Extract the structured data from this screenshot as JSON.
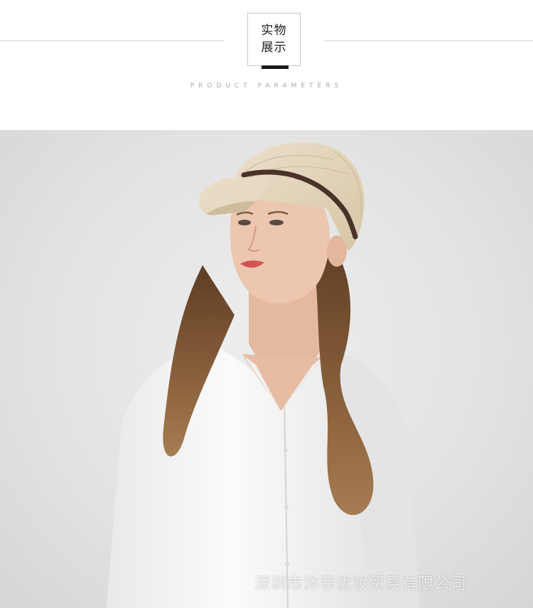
{
  "header": {
    "title_line1": "实物",
    "title_line2": "展示",
    "subtitle": "PRODUCT PARAMETERS"
  },
  "photo": {
    "subject": "woman-wearing-straw-visor-cap",
    "watermark": "深圳市沐菲优妆贸易有限公司"
  },
  "colors": {
    "rule": "#cfcfcf",
    "accent_bar": "#1a1a1a",
    "backdrop": "#e4e4e4",
    "hat": "#e2d3b9",
    "hat_band": "#4a3228",
    "hair": "#7a5434",
    "shirt": "#f7f7f7",
    "skin": "#e9c3ab"
  }
}
